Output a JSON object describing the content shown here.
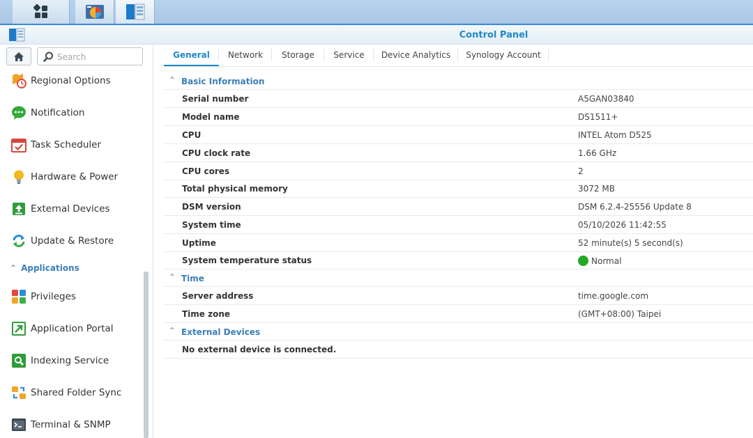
{
  "taskbar": {
    "buttons": [
      {
        "icon": "main-menu-icon"
      },
      {
        "icon": "package-center-icon"
      },
      {
        "icon": "control-panel-icon"
      }
    ]
  },
  "window": {
    "title": "Control Panel"
  },
  "sidebar": {
    "search_placeholder": "Search",
    "items_top": [
      {
        "label": "Regional Options",
        "icon": "regional-options-icon"
      },
      {
        "label": "Notification",
        "icon": "notification-icon"
      },
      {
        "label": "Task Scheduler",
        "icon": "task-scheduler-icon"
      },
      {
        "label": "Hardware & Power",
        "icon": "hardware-power-icon"
      },
      {
        "label": "External Devices",
        "icon": "external-devices-icon"
      },
      {
        "label": "Update & Restore",
        "icon": "update-restore-icon"
      }
    ],
    "section_label": "Applications",
    "items_apps": [
      {
        "label": "Privileges",
        "icon": "privileges-icon"
      },
      {
        "label": "Application Portal",
        "icon": "application-portal-icon"
      },
      {
        "label": "Indexing Service",
        "icon": "indexing-service-icon"
      },
      {
        "label": "Shared Folder Sync",
        "icon": "shared-folder-sync-icon"
      },
      {
        "label": "Terminal & SNMP",
        "icon": "terminal-snmp-icon"
      }
    ]
  },
  "tabs": [
    "General",
    "Network",
    "Storage",
    "Service",
    "Device Analytics",
    "Synology Account"
  ],
  "active_tab": "General",
  "basic_info": {
    "title": "Basic Information",
    "rows": [
      {
        "label": "Serial number",
        "value": "A5GAN03840"
      },
      {
        "label": "Model name",
        "value": "DS1511+"
      },
      {
        "label": "CPU",
        "value": "INTEL Atom D525"
      },
      {
        "label": "CPU clock rate",
        "value": "1.66 GHz"
      },
      {
        "label": "CPU cores",
        "value": "2"
      },
      {
        "label": "Total physical memory",
        "value": "3072 MB"
      },
      {
        "label": "DSM version",
        "value": "DSM 6.2.4-25556 Update 8"
      },
      {
        "label": "System time",
        "value": "05/10/2026 11:42:55"
      },
      {
        "label": "Uptime",
        "value": "52 minute(s) 5 second(s)"
      },
      {
        "label": "System temperature status",
        "value": "Normal"
      }
    ]
  },
  "time": {
    "title": "Time",
    "rows": [
      {
        "label": "Server address",
        "value": "time.google.com"
      },
      {
        "label": "Time zone",
        "value": "(GMT+08:00) Taipei"
      }
    ]
  },
  "external_devices": {
    "title": "External Devices",
    "message": "No external device is connected."
  },
  "colors": {
    "accent": "#1f88c8",
    "section": "#3b7fb8",
    "status_ok": "#25a725"
  }
}
